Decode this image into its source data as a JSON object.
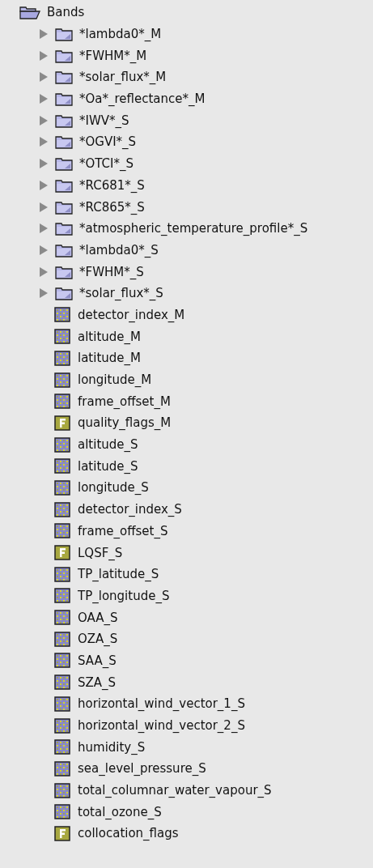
{
  "tree": {
    "label": "Bands",
    "expanded": true,
    "children": [
      {
        "kind": "folder",
        "label": "*lambda0*_M",
        "expanded": false
      },
      {
        "kind": "folder",
        "label": "*FWHM*_M",
        "expanded": false
      },
      {
        "kind": "folder",
        "label": "*solar_flux*_M",
        "expanded": false
      },
      {
        "kind": "folder",
        "label": "*Oa*_reflectance*_M",
        "expanded": false
      },
      {
        "kind": "folder",
        "label": "*IWV*_S",
        "expanded": false
      },
      {
        "kind": "folder",
        "label": "*OGVI*_S",
        "expanded": false
      },
      {
        "kind": "folder",
        "label": "*OTCI*_S",
        "expanded": false
      },
      {
        "kind": "folder",
        "label": "*RC681*_S",
        "expanded": false
      },
      {
        "kind": "folder",
        "label": "*RC865*_S",
        "expanded": false
      },
      {
        "kind": "folder",
        "label": "*atmospheric_temperature_profile*_S",
        "expanded": false
      },
      {
        "kind": "folder",
        "label": "*lambda0*_S",
        "expanded": false
      },
      {
        "kind": "folder",
        "label": "*FWHM*_S",
        "expanded": false
      },
      {
        "kind": "folder",
        "label": "*solar_flux*_S",
        "expanded": false
      },
      {
        "kind": "band",
        "label": "detector_index_M"
      },
      {
        "kind": "band",
        "label": "altitude_M"
      },
      {
        "kind": "band",
        "label": "latitude_M"
      },
      {
        "kind": "band",
        "label": "longitude_M"
      },
      {
        "kind": "band",
        "label": "frame_offset_M"
      },
      {
        "kind": "flag",
        "label": "quality_flags_M"
      },
      {
        "kind": "band",
        "label": "altitude_S"
      },
      {
        "kind": "band",
        "label": "latitude_S"
      },
      {
        "kind": "band",
        "label": "longitude_S"
      },
      {
        "kind": "band",
        "label": "detector_index_S"
      },
      {
        "kind": "band",
        "label": "frame_offset_S"
      },
      {
        "kind": "flag",
        "label": "LQSF_S"
      },
      {
        "kind": "band",
        "label": "TP_latitude_S"
      },
      {
        "kind": "band",
        "label": "TP_longitude_S"
      },
      {
        "kind": "band",
        "label": "OAA_S"
      },
      {
        "kind": "band",
        "label": "OZA_S"
      },
      {
        "kind": "band",
        "label": "SAA_S"
      },
      {
        "kind": "band",
        "label": "SZA_S"
      },
      {
        "kind": "band",
        "label": "horizontal_wind_vector_1_S"
      },
      {
        "kind": "band",
        "label": "horizontal_wind_vector_2_S"
      },
      {
        "kind": "band",
        "label": "humidity_S"
      },
      {
        "kind": "band",
        "label": "sea_level_pressure_S"
      },
      {
        "kind": "band",
        "label": "total_columnar_water_vapour_S"
      },
      {
        "kind": "band",
        "label": "total_ozone_S"
      },
      {
        "kind": "flag",
        "label": "collocation_flags"
      }
    ]
  }
}
